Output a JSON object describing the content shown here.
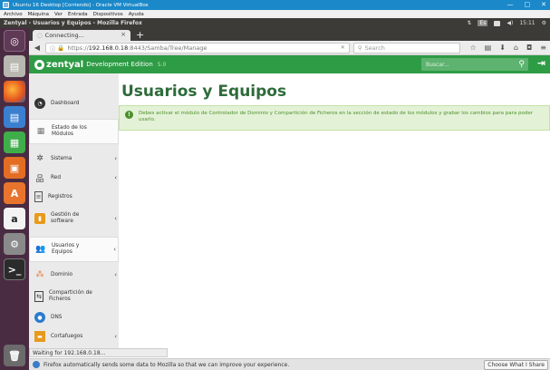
{
  "vbox": {
    "title": "Ubuntu 16 Desktop [Corriendo] - Oracle VM VirtualBox",
    "menu": [
      "Archivo",
      "Máquina",
      "Ver",
      "Entrada",
      "Dispositivos",
      "Ayuda"
    ],
    "min": "—",
    "max": "□",
    "close": "✕"
  },
  "ubuntu": {
    "window_title": "Zentyal - Usuarios y Equipos - Mozilla Firefox",
    "kbd": "Es",
    "clock": "15:11"
  },
  "firefox": {
    "tab_title": "Connecting...",
    "tab_close": "×",
    "new_tab": "+",
    "url_prefix": "https://",
    "url_host": "192.168.0.18",
    "url_rest": ":8443/Samba/Tree/Manage",
    "search_placeholder": "Search",
    "status_text": "Waiting for 192.168.0.18...",
    "notification": "Firefox automatically sends some data to Mozilla so that we can improve your experience.",
    "choose_button": "Choose What I Share"
  },
  "zentyal": {
    "brand": "zentyal",
    "edition": "Development Edition",
    "version": "5.0",
    "search_placeholder": "Buscar...",
    "page_title": "Usuarios y Equipos",
    "alert": "Debes activar el módulo de Controlador de Dominio y Compartición de Ficheros en la sección de estado de los módulos y grabar los cambios para para poder usarlo.",
    "menu": [
      {
        "label": "Dashboard",
        "icon": "dashboard-icon",
        "arrow": ""
      },
      {
        "label": "Estado de los Módulos",
        "icon": "modules-icon",
        "arrow": ""
      },
      {
        "label": "Sistema",
        "icon": "gear-icon",
        "arrow": "‹"
      },
      {
        "label": "Red",
        "icon": "network-icon",
        "arrow": "‹"
      },
      {
        "label": "Registros",
        "icon": "logs-icon",
        "arrow": ""
      },
      {
        "label": "Gestión de software",
        "icon": "software-icon",
        "arrow": "‹"
      },
      {
        "label": "Usuarios y Equipos",
        "icon": "users-icon",
        "arrow": "‹"
      },
      {
        "label": "Dominio",
        "icon": "domain-icon",
        "arrow": "‹"
      },
      {
        "label": "Compartición de Ficheros",
        "icon": "file-share-icon",
        "arrow": ""
      },
      {
        "label": "DNS",
        "icon": "dns-icon",
        "arrow": ""
      },
      {
        "label": "Cortafuegos",
        "icon": "firewall-icon",
        "arrow": "‹"
      }
    ]
  }
}
